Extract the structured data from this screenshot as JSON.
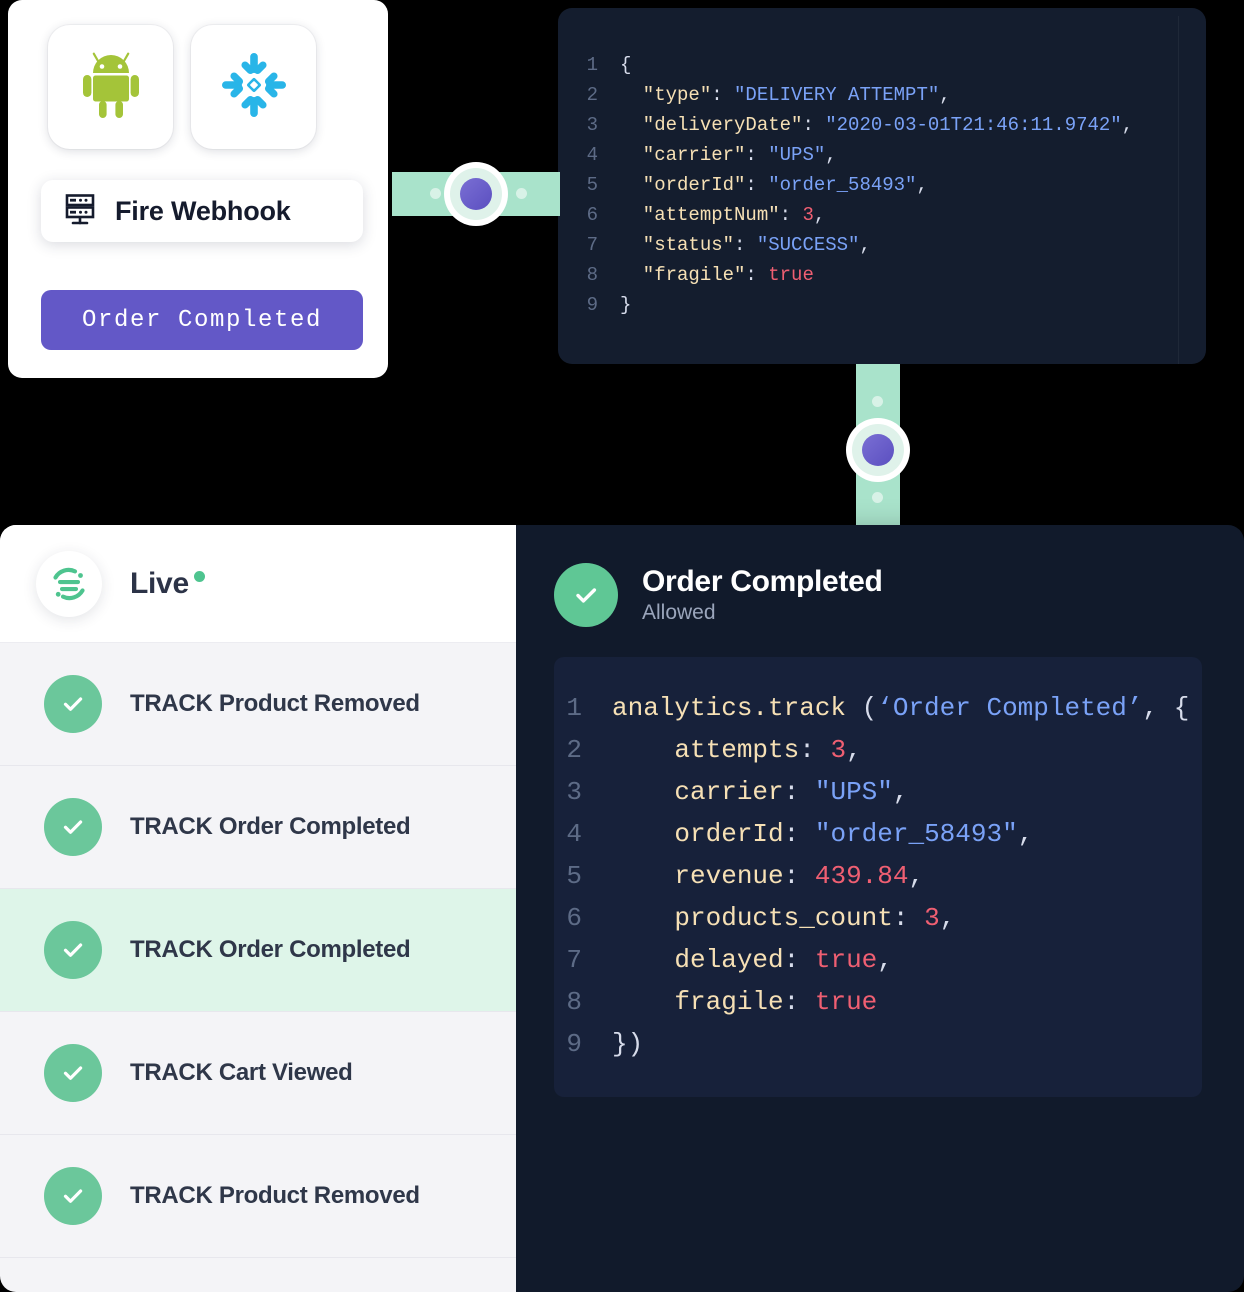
{
  "source_card": {
    "integrations": [
      {
        "name": "android-icon",
        "label": "Android",
        "color": "#A4C439"
      },
      {
        "name": "snowflake-icon",
        "label": "Snowflake",
        "color": "#29B5E8"
      }
    ],
    "action": {
      "icon": "server-rack-icon",
      "label": "Fire Webhook"
    },
    "event_button": {
      "label": "Order Completed",
      "color": "#6358C7"
    }
  },
  "webhook_payload": {
    "language": "json",
    "lines": [
      {
        "num": "1",
        "tokens": [
          {
            "t": "{",
            "c": "p"
          }
        ]
      },
      {
        "num": "2",
        "tokens": [
          {
            "t": "  \"type\"",
            "c": "k"
          },
          {
            "t": ": ",
            "c": "p"
          },
          {
            "t": "\"DELIVERY ATTEMPT\"",
            "c": "s"
          },
          {
            "t": ",",
            "c": "p"
          }
        ]
      },
      {
        "num": "3",
        "tokens": [
          {
            "t": "  \"deliveryDate\"",
            "c": "k"
          },
          {
            "t": ": ",
            "c": "p"
          },
          {
            "t": "\"2020-03-01T21:46:11.9742\"",
            "c": "s"
          },
          {
            "t": ",",
            "c": "p"
          }
        ]
      },
      {
        "num": "4",
        "tokens": [
          {
            "t": "  \"carrier\"",
            "c": "k"
          },
          {
            "t": ": ",
            "c": "p"
          },
          {
            "t": "\"UPS\"",
            "c": "s"
          },
          {
            "t": ",",
            "c": "p"
          }
        ]
      },
      {
        "num": "5",
        "tokens": [
          {
            "t": "  \"orderId\"",
            "c": "k"
          },
          {
            "t": ": ",
            "c": "p"
          },
          {
            "t": "\"order_58493\"",
            "c": "s"
          },
          {
            "t": ",",
            "c": "p"
          }
        ]
      },
      {
        "num": "6",
        "tokens": [
          {
            "t": "  \"attemptNum\"",
            "c": "k"
          },
          {
            "t": ": ",
            "c": "p"
          },
          {
            "t": "3",
            "c": "n"
          },
          {
            "t": ",",
            "c": "p"
          }
        ]
      },
      {
        "num": "7",
        "tokens": [
          {
            "t": "  \"status\"",
            "c": "k"
          },
          {
            "t": ": ",
            "c": "p"
          },
          {
            "t": "\"SUCCESS\"",
            "c": "s"
          },
          {
            "t": ",",
            "c": "p"
          }
        ]
      },
      {
        "num": "8",
        "tokens": [
          {
            "t": "  \"fragile\"",
            "c": "k"
          },
          {
            "t": ": ",
            "c": "p"
          },
          {
            "t": "true",
            "c": "b"
          }
        ]
      },
      {
        "num": "9",
        "tokens": [
          {
            "t": "}",
            "c": "p"
          }
        ]
      }
    ]
  },
  "event_stream": {
    "header": {
      "logo": "segment-logo",
      "title": "Live",
      "status_dot_color": "#4ec48f"
    },
    "rows": [
      {
        "icon": "check-circle-icon",
        "label": "TRACK Product Removed",
        "highlighted": false
      },
      {
        "icon": "check-circle-icon",
        "label": "TRACK Order Completed",
        "highlighted": false
      },
      {
        "icon": "check-circle-icon",
        "label": "TRACK Order Completed",
        "highlighted": true
      },
      {
        "icon": "check-circle-icon",
        "label": "TRACK Cart Viewed",
        "highlighted": false
      },
      {
        "icon": "check-circle-icon",
        "label": "TRACK Product Removed",
        "highlighted": false
      }
    ]
  },
  "event_detail": {
    "icon": "check-circle-icon",
    "title": "Order Completed",
    "subtitle": "Allowed",
    "code": {
      "language": "javascript",
      "lines": [
        {
          "num": "1",
          "tokens": [
            {
              "t": "analytics.track ",
              "c": "fn"
            },
            {
              "t": "(",
              "c": "p"
            },
            {
              "t": "‘Order Completed’",
              "c": "s"
            },
            {
              "t": ", {",
              "c": "p"
            }
          ]
        },
        {
          "num": "2",
          "tokens": [
            {
              "t": "    attempts",
              "c": "k"
            },
            {
              "t": ": ",
              "c": "p"
            },
            {
              "t": "3",
              "c": "n"
            },
            {
              "t": ",",
              "c": "p"
            }
          ]
        },
        {
          "num": "3",
          "tokens": [
            {
              "t": "    carrier",
              "c": "k"
            },
            {
              "t": ": ",
              "c": "p"
            },
            {
              "t": "\"UPS\"",
              "c": "s"
            },
            {
              "t": ",",
              "c": "p"
            }
          ]
        },
        {
          "num": "4",
          "tokens": [
            {
              "t": "    orderId",
              "c": "k"
            },
            {
              "t": ": ",
              "c": "p"
            },
            {
              "t": "\"order_58493\"",
              "c": "s"
            },
            {
              "t": ",",
              "c": "p"
            }
          ]
        },
        {
          "num": "5",
          "tokens": [
            {
              "t": "    revenue",
              "c": "k"
            },
            {
              "t": ": ",
              "c": "p"
            },
            {
              "t": "439.84",
              "c": "n"
            },
            {
              "t": ",",
              "c": "p"
            }
          ]
        },
        {
          "num": "6",
          "tokens": [
            {
              "t": "    products_count",
              "c": "k"
            },
            {
              "t": ": ",
              "c": "p"
            },
            {
              "t": "3",
              "c": "n"
            },
            {
              "t": ",",
              "c": "p"
            }
          ]
        },
        {
          "num": "7",
          "tokens": [
            {
              "t": "    delayed",
              "c": "k"
            },
            {
              "t": ": ",
              "c": "p"
            },
            {
              "t": "true",
              "c": "b"
            },
            {
              "t": ",",
              "c": "p"
            }
          ]
        },
        {
          "num": "8",
          "tokens": [
            {
              "t": "    fragile",
              "c": "k"
            },
            {
              "t": ": ",
              "c": "p"
            },
            {
              "t": "true",
              "c": "b"
            }
          ]
        },
        {
          "num": "9",
          "tokens": [
            {
              "t": "})",
              "c": "p"
            }
          ]
        }
      ]
    }
  },
  "connectors": [
    {
      "name": "webhook-to-payload-connector",
      "orientation": "horizontal",
      "color": "#a9e3cb",
      "node_color": "#6358C7"
    },
    {
      "name": "payload-to-stream-connector",
      "orientation": "vertical",
      "color": "#a9e3cb",
      "node_color": "#6358C7"
    }
  ]
}
